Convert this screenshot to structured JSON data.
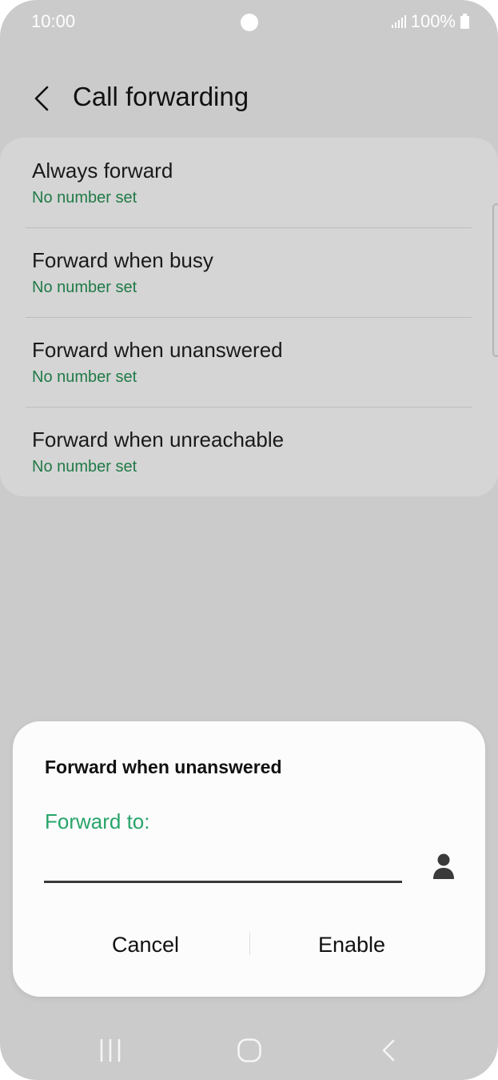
{
  "status_bar": {
    "time": "10:00",
    "battery": "100%"
  },
  "header": {
    "title": "Call forwarding",
    "back_icon": "chevron-left-icon"
  },
  "forwarding_options": [
    {
      "title": "Always forward",
      "subtitle": "No number set"
    },
    {
      "title": "Forward when busy",
      "subtitle": "No number set"
    },
    {
      "title": "Forward when unanswered",
      "subtitle": "No number set"
    },
    {
      "title": "Forward when unreachable",
      "subtitle": "No number set"
    }
  ],
  "dialog": {
    "title": "Forward when unanswered",
    "field_label": "Forward to:",
    "input_value": "",
    "contact_icon": "contact-person-icon",
    "cancel_label": "Cancel",
    "enable_label": "Enable"
  },
  "navigation": {
    "recents_icon": "recents-icon",
    "home_icon": "home-icon",
    "back_icon": "back-icon"
  },
  "colors": {
    "background": "#cbcbcb",
    "list_card": "#d5d5d5",
    "subtitle_green": "#1f7a47",
    "accent_green": "#29a46a",
    "dialog_bg": "#fcfcfc"
  }
}
